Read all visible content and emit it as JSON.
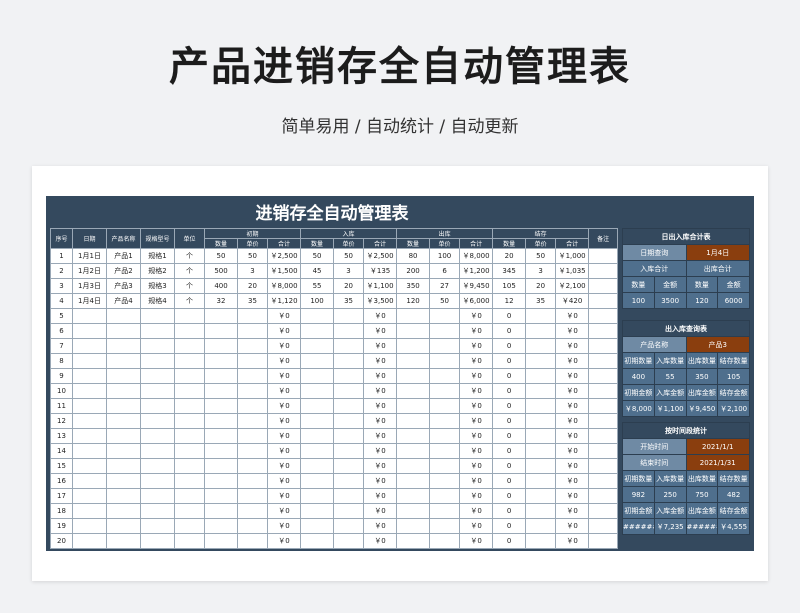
{
  "page": {
    "title": "产品进销存全自动管理表",
    "subtitle": "简单易用 / 自动统计 / 自动更新"
  },
  "sheet": {
    "title": "进销存全自动管理表",
    "header_main": [
      "序号",
      "日期",
      "产品名称",
      "规格型号",
      "单位"
    ],
    "groups": [
      "初期",
      "入库",
      "出库",
      "结存"
    ],
    "sub_cols": [
      "数量",
      "单价",
      "合计"
    ],
    "remark": "备注",
    "rows": [
      [
        "1",
        "1月1日",
        "产品1",
        "规格1",
        "个",
        "50",
        "50",
        "￥2,500",
        "50",
        "50",
        "￥2,500",
        "80",
        "100",
        "￥8,000",
        "20",
        "50",
        "￥1,000",
        ""
      ],
      [
        "2",
        "1月2日",
        "产品2",
        "规格2",
        "个",
        "500",
        "3",
        "￥1,500",
        "45",
        "3",
        "￥135",
        "200",
        "6",
        "￥1,200",
        "345",
        "3",
        "￥1,035",
        ""
      ],
      [
        "3",
        "1月3日",
        "产品3",
        "规格3",
        "个",
        "400",
        "20",
        "￥8,000",
        "55",
        "20",
        "￥1,100",
        "350",
        "27",
        "￥9,450",
        "105",
        "20",
        "￥2,100",
        ""
      ],
      [
        "4",
        "1月4日",
        "产品4",
        "规格4",
        "个",
        "32",
        "35",
        "￥1,120",
        "100",
        "35",
        "￥3,500",
        "120",
        "50",
        "￥6,000",
        "12",
        "35",
        "￥420",
        ""
      ],
      [
        "5",
        "",
        "",
        "",
        "",
        "",
        "",
        "￥0",
        "",
        "",
        "￥0",
        "",
        "",
        "￥0",
        "0",
        "",
        "￥0",
        ""
      ],
      [
        "6",
        "",
        "",
        "",
        "",
        "",
        "",
        "￥0",
        "",
        "",
        "￥0",
        "",
        "",
        "￥0",
        "0",
        "",
        "￥0",
        ""
      ],
      [
        "7",
        "",
        "",
        "",
        "",
        "",
        "",
        "￥0",
        "",
        "",
        "￥0",
        "",
        "",
        "￥0",
        "0",
        "",
        "￥0",
        ""
      ],
      [
        "8",
        "",
        "",
        "",
        "",
        "",
        "",
        "￥0",
        "",
        "",
        "￥0",
        "",
        "",
        "￥0",
        "0",
        "",
        "￥0",
        ""
      ],
      [
        "9",
        "",
        "",
        "",
        "",
        "",
        "",
        "￥0",
        "",
        "",
        "￥0",
        "",
        "",
        "￥0",
        "0",
        "",
        "￥0",
        ""
      ],
      [
        "10",
        "",
        "",
        "",
        "",
        "",
        "",
        "￥0",
        "",
        "",
        "￥0",
        "",
        "",
        "￥0",
        "0",
        "",
        "￥0",
        ""
      ],
      [
        "11",
        "",
        "",
        "",
        "",
        "",
        "",
        "￥0",
        "",
        "",
        "￥0",
        "",
        "",
        "￥0",
        "0",
        "",
        "￥0",
        ""
      ],
      [
        "12",
        "",
        "",
        "",
        "",
        "",
        "",
        "￥0",
        "",
        "",
        "￥0",
        "",
        "",
        "￥0",
        "0",
        "",
        "￥0",
        ""
      ],
      [
        "13",
        "",
        "",
        "",
        "",
        "",
        "",
        "￥0",
        "",
        "",
        "￥0",
        "",
        "",
        "￥0",
        "0",
        "",
        "￥0",
        ""
      ],
      [
        "14",
        "",
        "",
        "",
        "",
        "",
        "",
        "￥0",
        "",
        "",
        "￥0",
        "",
        "",
        "￥0",
        "0",
        "",
        "￥0",
        ""
      ],
      [
        "15",
        "",
        "",
        "",
        "",
        "",
        "",
        "￥0",
        "",
        "",
        "￥0",
        "",
        "",
        "￥0",
        "0",
        "",
        "￥0",
        ""
      ],
      [
        "16",
        "",
        "",
        "",
        "",
        "",
        "",
        "￥0",
        "",
        "",
        "￥0",
        "",
        "",
        "￥0",
        "0",
        "",
        "￥0",
        ""
      ],
      [
        "17",
        "",
        "",
        "",
        "",
        "",
        "",
        "￥0",
        "",
        "",
        "￥0",
        "",
        "",
        "￥0",
        "0",
        "",
        "￥0",
        ""
      ],
      [
        "18",
        "",
        "",
        "",
        "",
        "",
        "",
        "￥0",
        "",
        "",
        "￥0",
        "",
        "",
        "￥0",
        "0",
        "",
        "￥0",
        ""
      ],
      [
        "19",
        "",
        "",
        "",
        "",
        "",
        "",
        "￥0",
        "",
        "",
        "￥0",
        "",
        "",
        "￥0",
        "0",
        "",
        "￥0",
        ""
      ],
      [
        "20",
        "",
        "",
        "",
        "",
        "",
        "",
        "￥0",
        "",
        "",
        "￥0",
        "",
        "",
        "￥0",
        "0",
        "",
        "￥0",
        ""
      ]
    ]
  },
  "panel_daily": {
    "title": "日出入库合计表",
    "query_label": "日期查询",
    "query_value": "1月4日",
    "in_label": "入库合计",
    "out_label": "出库合计",
    "cols": [
      "数量",
      "金额",
      "数量",
      "金额"
    ],
    "values": [
      "100",
      "3500",
      "120",
      "6000"
    ]
  },
  "panel_product": {
    "title": "出入库查询表",
    "query_label": "产品名称",
    "query_value": "产品3",
    "cols1": [
      "初期数量",
      "入库数量",
      "出库数量",
      "结存数量"
    ],
    "values1": [
      "400",
      "55",
      "350",
      "105"
    ],
    "cols2": [
      "初期金额",
      "入库金额",
      "出库金额",
      "结存金额"
    ],
    "values2": [
      "￥8,000",
      "￥1,100",
      "￥9,450",
      "￥2,100"
    ]
  },
  "panel_period": {
    "title": "按时间段统计",
    "start_label": "开始时间",
    "start_value": "2021/1/1",
    "end_label": "结束时间",
    "end_value": "2021/1/31",
    "cols1": [
      "初期数量",
      "入库数量",
      "出库数量",
      "结存数量"
    ],
    "values1": [
      "982",
      "250",
      "750",
      "482"
    ],
    "cols2": [
      "初期金额",
      "入库金额",
      "出库金额",
      "结存金额"
    ],
    "values2": [
      "#######",
      "￥7,235",
      "#######",
      "￥4,555"
    ]
  }
}
